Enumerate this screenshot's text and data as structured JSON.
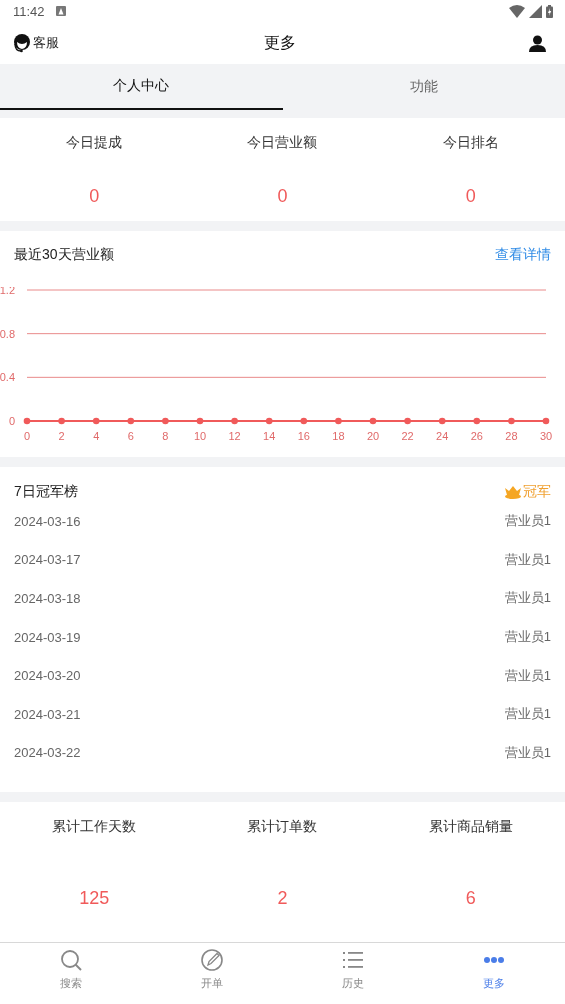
{
  "status_bar": {
    "time": "11:42"
  },
  "header": {
    "left_label": "客服",
    "title": "更多"
  },
  "tabs": [
    {
      "label": "个人中心",
      "selected": true
    },
    {
      "label": "功能",
      "selected": false
    }
  ],
  "today_stats": [
    {
      "label": "今日提成",
      "value": "0"
    },
    {
      "label": "今日营业额",
      "value": "0"
    },
    {
      "label": "今日排名",
      "value": "0"
    }
  ],
  "sales_chart": {
    "title": "最近30天营业额",
    "link": "查看详情",
    "chart_data": {
      "type": "line",
      "x": [
        0,
        2,
        4,
        6,
        8,
        10,
        12,
        14,
        16,
        18,
        20,
        22,
        24,
        26,
        28,
        30
      ],
      "series": [
        {
          "color": "#f05a5a",
          "marker": "circle",
          "values": [
            0,
            0,
            0,
            0,
            0,
            0,
            0,
            0,
            0,
            0,
            0,
            0,
            0,
            0,
            0,
            0
          ]
        }
      ],
      "xlim": [
        0,
        30
      ],
      "ylim": [
        0,
        1.2
      ],
      "xticks": [
        0,
        2,
        4,
        6,
        8,
        10,
        12,
        14,
        16,
        18,
        20,
        22,
        24,
        26,
        28,
        30
      ],
      "yticks": [
        0,
        0.4,
        0.8,
        1.2
      ]
    }
  },
  "champions": {
    "title": "7日冠军榜",
    "badge": "冠军",
    "rows": [
      {
        "date": "2024-03-16",
        "name": "营业员1"
      },
      {
        "date": "2024-03-17",
        "name": "营业员1"
      },
      {
        "date": "2024-03-18",
        "name": "营业员1"
      },
      {
        "date": "2024-03-19",
        "name": "营业员1"
      },
      {
        "date": "2024-03-20",
        "name": "营业员1"
      },
      {
        "date": "2024-03-21",
        "name": "营业员1"
      },
      {
        "date": "2024-03-22",
        "name": "营业员1"
      }
    ]
  },
  "totals": [
    {
      "label": "累计工作天数",
      "value": "125"
    },
    {
      "label": "累计订单数",
      "value": "2"
    },
    {
      "label": "累计商品销量",
      "value": "6"
    }
  ],
  "bottom_nav": [
    {
      "label": "搜索",
      "kind": "search",
      "selected": false
    },
    {
      "label": "开单",
      "kind": "edit",
      "selected": false
    },
    {
      "label": "历史",
      "kind": "list",
      "selected": false
    },
    {
      "label": "更多",
      "kind": "more",
      "selected": true
    }
  ]
}
